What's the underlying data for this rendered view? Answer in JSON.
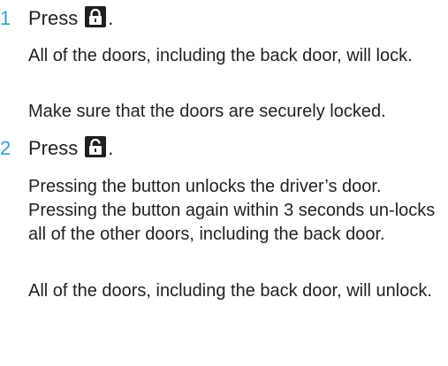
{
  "steps": [
    {
      "number": "1",
      "press_label": "Press",
      "icon": "lock-closed-icon",
      "punct": ".",
      "paragraphs": [
        "All of the doors, including the back door, will lock.",
        "Make sure that the doors are securely locked."
      ]
    },
    {
      "number": "2",
      "press_label": "Press",
      "icon": "lock-open-icon",
      "punct": ".",
      "paragraphs": [
        "Pressing the button unlocks the driver’s door. Pressing the button again within 3 seconds un-locks all of the other doors, including the back door.",
        "All of the doors, including the back door, will unlock."
      ]
    }
  ]
}
